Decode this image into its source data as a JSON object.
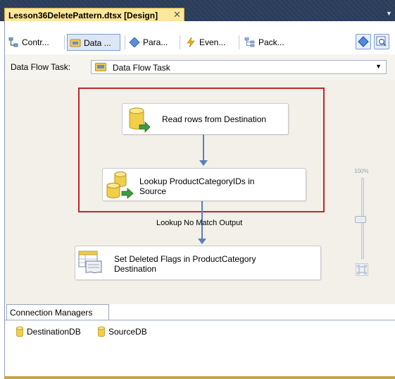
{
  "document_tab": {
    "title": "Lesson36DeletePattern.dtsx [Design]",
    "close_symbol": "✕"
  },
  "designer_tabs": [
    {
      "label": "Contr...",
      "icon": "control-flow-icon"
    },
    {
      "label": "Data ...",
      "icon": "data-flow-icon",
      "active": true
    },
    {
      "label": "Para...",
      "icon": "parameters-icon"
    },
    {
      "label": "Even...",
      "icon": "event-handlers-icon"
    },
    {
      "label": "Pack...",
      "icon": "package-explorer-icon"
    }
  ],
  "data_flow_task": {
    "label": "Data Flow Task:",
    "selected": "Data Flow Task"
  },
  "components": {
    "source": {
      "label": "Read rows from Destination",
      "icon": "source-database-icon"
    },
    "lookup": {
      "label_line1": "Lookup ProductCategoryIDs in",
      "label_line2": "Source",
      "icon": "lookup-icon"
    },
    "destination": {
      "label_line1": "Set Deleted Flags in ProductCategory",
      "label_line2": "Destination",
      "icon": "ole-db-command-icon"
    }
  },
  "path_label": "Lookup No Match Output",
  "zoom": {
    "label": "100%",
    "level_percent": 100
  },
  "connection_managers": {
    "tab_label": "Connection Managers",
    "items": [
      {
        "label": "DestinationDB",
        "icon": "connection-icon"
      },
      {
        "label": "SourceDB",
        "icon": "connection-icon"
      }
    ]
  },
  "colors": {
    "highlight": "#c0262d",
    "tab_active": "#fde79a",
    "canvas": "#f2f0e8",
    "path": "#5b7fb8"
  }
}
